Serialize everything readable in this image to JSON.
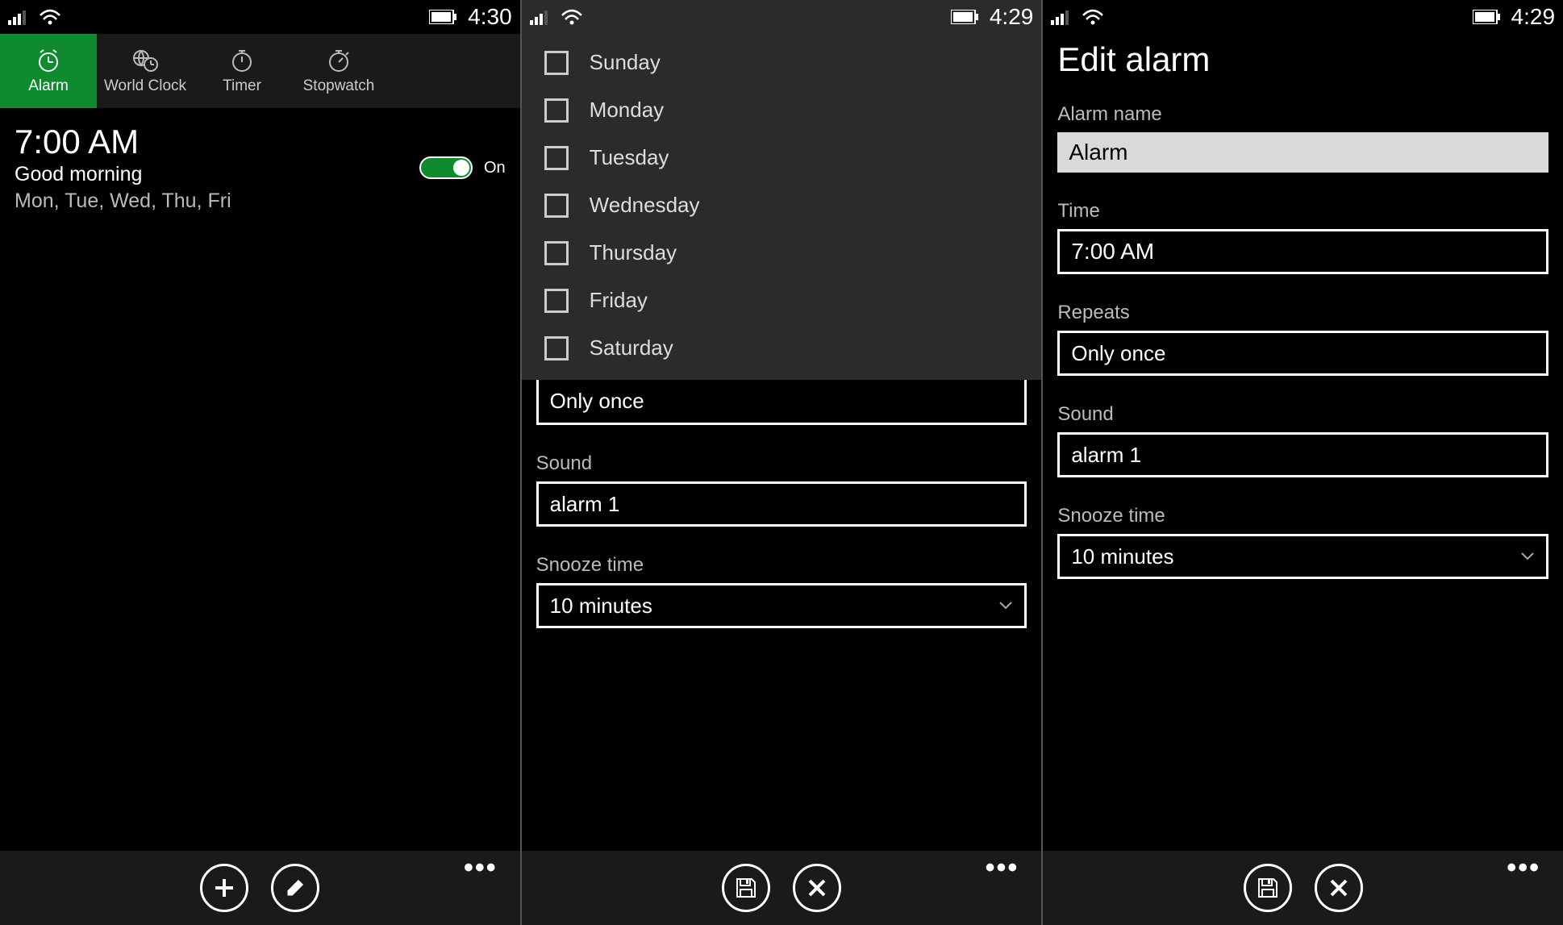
{
  "status": {
    "time1": "4:30",
    "time2": "4:29",
    "time3": "4:29"
  },
  "tabs": {
    "alarm": "Alarm",
    "world": "World Clock",
    "timer": "Timer",
    "stopwatch": "Stopwatch"
  },
  "alarm": {
    "time": "7:00 AM",
    "label": "Good morning",
    "days": "Mon, Tue, Wed, Thu, Fri",
    "toggle_state": "On"
  },
  "days": {
    "sun": "Sunday",
    "mon": "Monday",
    "tue": "Tuesday",
    "wed": "Wednesday",
    "thu": "Thursday",
    "fri": "Friday",
    "sat": "Saturday"
  },
  "form": {
    "repeats_value": "Only once",
    "sound_label": "Sound",
    "sound_value": "alarm 1",
    "snooze_label": "Snooze time",
    "snooze_value": "10 minutes"
  },
  "edit": {
    "title": "Edit alarm",
    "name_label": "Alarm name",
    "name_value": "Alarm",
    "time_label": "Time",
    "time_value": "7:00 AM",
    "repeats_label": "Repeats",
    "repeats_value": "Only once",
    "sound_label": "Sound",
    "sound_value": "alarm 1",
    "snooze_label": "Snooze time",
    "snooze_value": "10 minutes"
  }
}
